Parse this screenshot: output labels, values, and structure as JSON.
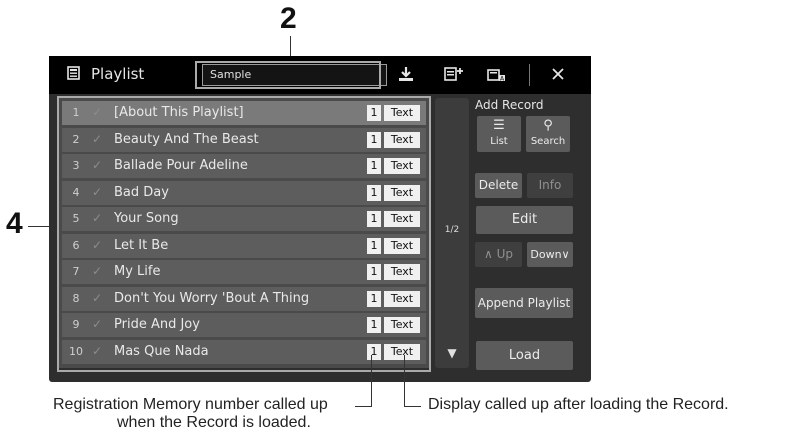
{
  "callouts": {
    "list_number": "4",
    "name_number": "2"
  },
  "annotations": {
    "registration": "Registration Memory number called up\nwhen the Record is loaded.",
    "registration_line1": "Registration Memory number called up",
    "registration_line2": "when the Record is loaded.",
    "display": "Display called up after loading the Record."
  },
  "header": {
    "title": "Playlist",
    "playlist_name": "Sample",
    "icons": [
      "playlist-icon",
      "save-icon",
      "add-page-icon",
      "rename-icon",
      "close-icon"
    ]
  },
  "playlist": {
    "rows": [
      {
        "num": "1",
        "check": "✓",
        "title": "[About This Playlist]",
        "reg": "1",
        "text": "Text"
      },
      {
        "num": "2",
        "check": "✓",
        "title": "Beauty And The Beast",
        "reg": "1",
        "text": "Text"
      },
      {
        "num": "3",
        "check": "✓",
        "title": "Ballade Pour Adeline",
        "reg": "1",
        "text": "Text"
      },
      {
        "num": "4",
        "check": "✓",
        "title": "Bad Day",
        "reg": "1",
        "text": "Text"
      },
      {
        "num": "5",
        "check": "✓",
        "title": "Your Song",
        "reg": "1",
        "text": "Text"
      },
      {
        "num": "6",
        "check": "✓",
        "title": "Let It Be",
        "reg": "1",
        "text": "Text"
      },
      {
        "num": "7",
        "check": "✓",
        "title": "My Life",
        "reg": "1",
        "text": "Text"
      },
      {
        "num": "8",
        "check": "✓",
        "title": "Don't You Worry 'Bout A Thing",
        "reg": "1",
        "text": "Text"
      },
      {
        "num": "9",
        "check": "✓",
        "title": "Pride And Joy",
        "reg": "1",
        "text": "Text"
      },
      {
        "num": "10",
        "check": "✓",
        "title": "Mas Que Nada",
        "reg": "1",
        "text": "Text"
      }
    ],
    "page_indicator": "1/2",
    "scroll_down": "▼"
  },
  "panel": {
    "add_record_label": "Add Record",
    "list_button": "List",
    "search_button": "Search",
    "delete_button": "Delete",
    "info_button": "Info",
    "edit_button": "Edit",
    "up_button": "∧ Up",
    "down_button": "Down∨",
    "append_button": "Append Playlist",
    "load_button": "Load"
  },
  "colors": {
    "screen_bg": "#2e2e2e",
    "header_bg": "#000000",
    "row_bg": "#5d5d5d",
    "selected_row_bg": "#7a7a7a"
  }
}
